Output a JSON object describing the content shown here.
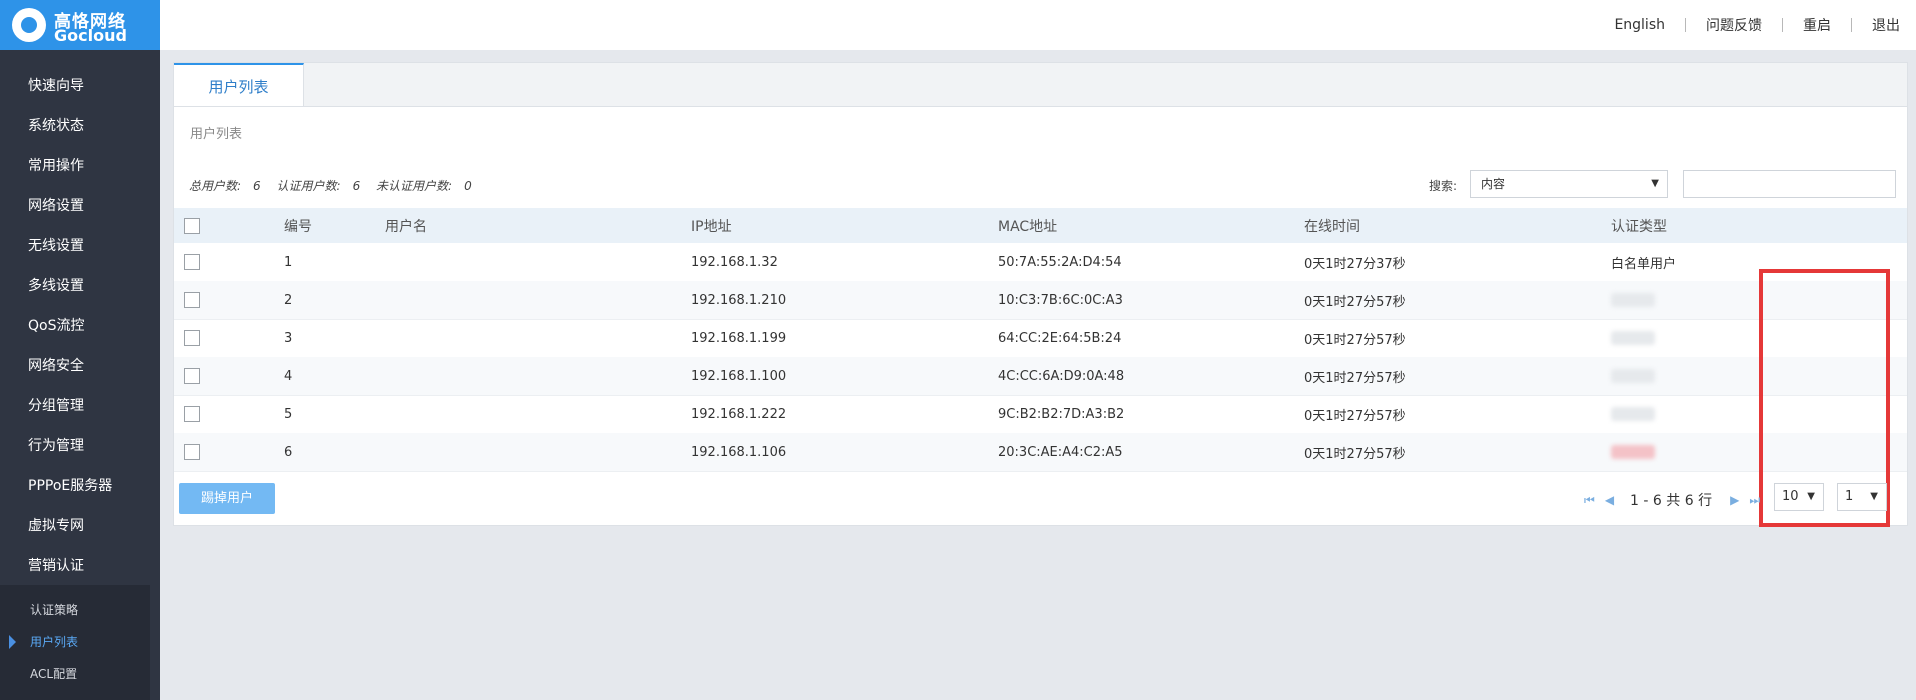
{
  "brand": {
    "name_cn": "高恪网络",
    "name_en": "Gocloud"
  },
  "sidebar": {
    "items": [
      {
        "label": "快速向导"
      },
      {
        "label": "系统状态"
      },
      {
        "label": "常用操作"
      },
      {
        "label": "网络设置"
      },
      {
        "label": "无线设置"
      },
      {
        "label": "多线设置"
      },
      {
        "label": "QoS流控"
      },
      {
        "label": "网络安全"
      },
      {
        "label": "分组管理"
      },
      {
        "label": "行为管理"
      },
      {
        "label": "PPPoE服务器"
      },
      {
        "label": "虚拟专网"
      },
      {
        "label": "营销认证"
      }
    ],
    "subitems": [
      {
        "label": "认证策略"
      },
      {
        "label": "用户列表"
      },
      {
        "label": "ACL配置"
      }
    ]
  },
  "topbar": {
    "links": [
      "English",
      "问题反馈",
      "重启",
      "退出"
    ]
  },
  "tab": {
    "label": "用户列表"
  },
  "subtitle": "用户列表",
  "stats": {
    "total_label": "总用户数:",
    "total": "6",
    "auth_label": "认证用户数:",
    "auth": "6",
    "unauth_label": "未认证用户数:",
    "unauth": "0"
  },
  "search": {
    "label": "搜索:",
    "selected": "内容"
  },
  "table": {
    "headers": {
      "index": "编号",
      "username": "用户名",
      "ip": "IP地址",
      "mac": "MAC地址",
      "online": "在线时间",
      "auth_type": "认证类型"
    },
    "rows": [
      {
        "index": "1",
        "username": "",
        "ip": "192.168.1.32",
        "mac": "50:7A:55:2A:D4:54",
        "online": "0天1时27分37秒",
        "auth_type": "白名单用户"
      },
      {
        "index": "2",
        "username": "",
        "ip": "192.168.1.210",
        "mac": "10:C3:7B:6C:0C:A3",
        "online": "0天1时27分57秒",
        "auth_type": ""
      },
      {
        "index": "3",
        "username": "",
        "ip": "192.168.1.199",
        "mac": "64:CC:2E:64:5B:24",
        "online": "0天1时27分57秒",
        "auth_type": ""
      },
      {
        "index": "4",
        "username": "",
        "ip": "192.168.1.100",
        "mac": "4C:CC:6A:D9:0A:48",
        "online": "0天1时27分57秒",
        "auth_type": ""
      },
      {
        "index": "5",
        "username": "",
        "ip": "192.168.1.222",
        "mac": "9C:B2:B2:7D:A3:B2",
        "online": "0天1时27分57秒",
        "auth_type": ""
      },
      {
        "index": "6",
        "username": "",
        "ip": "192.168.1.106",
        "mac": "20:3C:AE:A4:C2:A5",
        "online": "0天1时27分57秒",
        "auth_type": ""
      }
    ]
  },
  "actions": {
    "kick": "踢掉用户"
  },
  "pager": {
    "info": "1 - 6 共 6 行",
    "page_size": "10",
    "page": "1"
  },
  "colors": {
    "accent": "#2e93e8",
    "sidebar": "#2f3542",
    "highlight": "#e53838"
  },
  "icons": {
    "first": "first-page-icon",
    "prev": "prev-page-icon",
    "next": "next-page-icon",
    "last": "last-page-icon"
  }
}
